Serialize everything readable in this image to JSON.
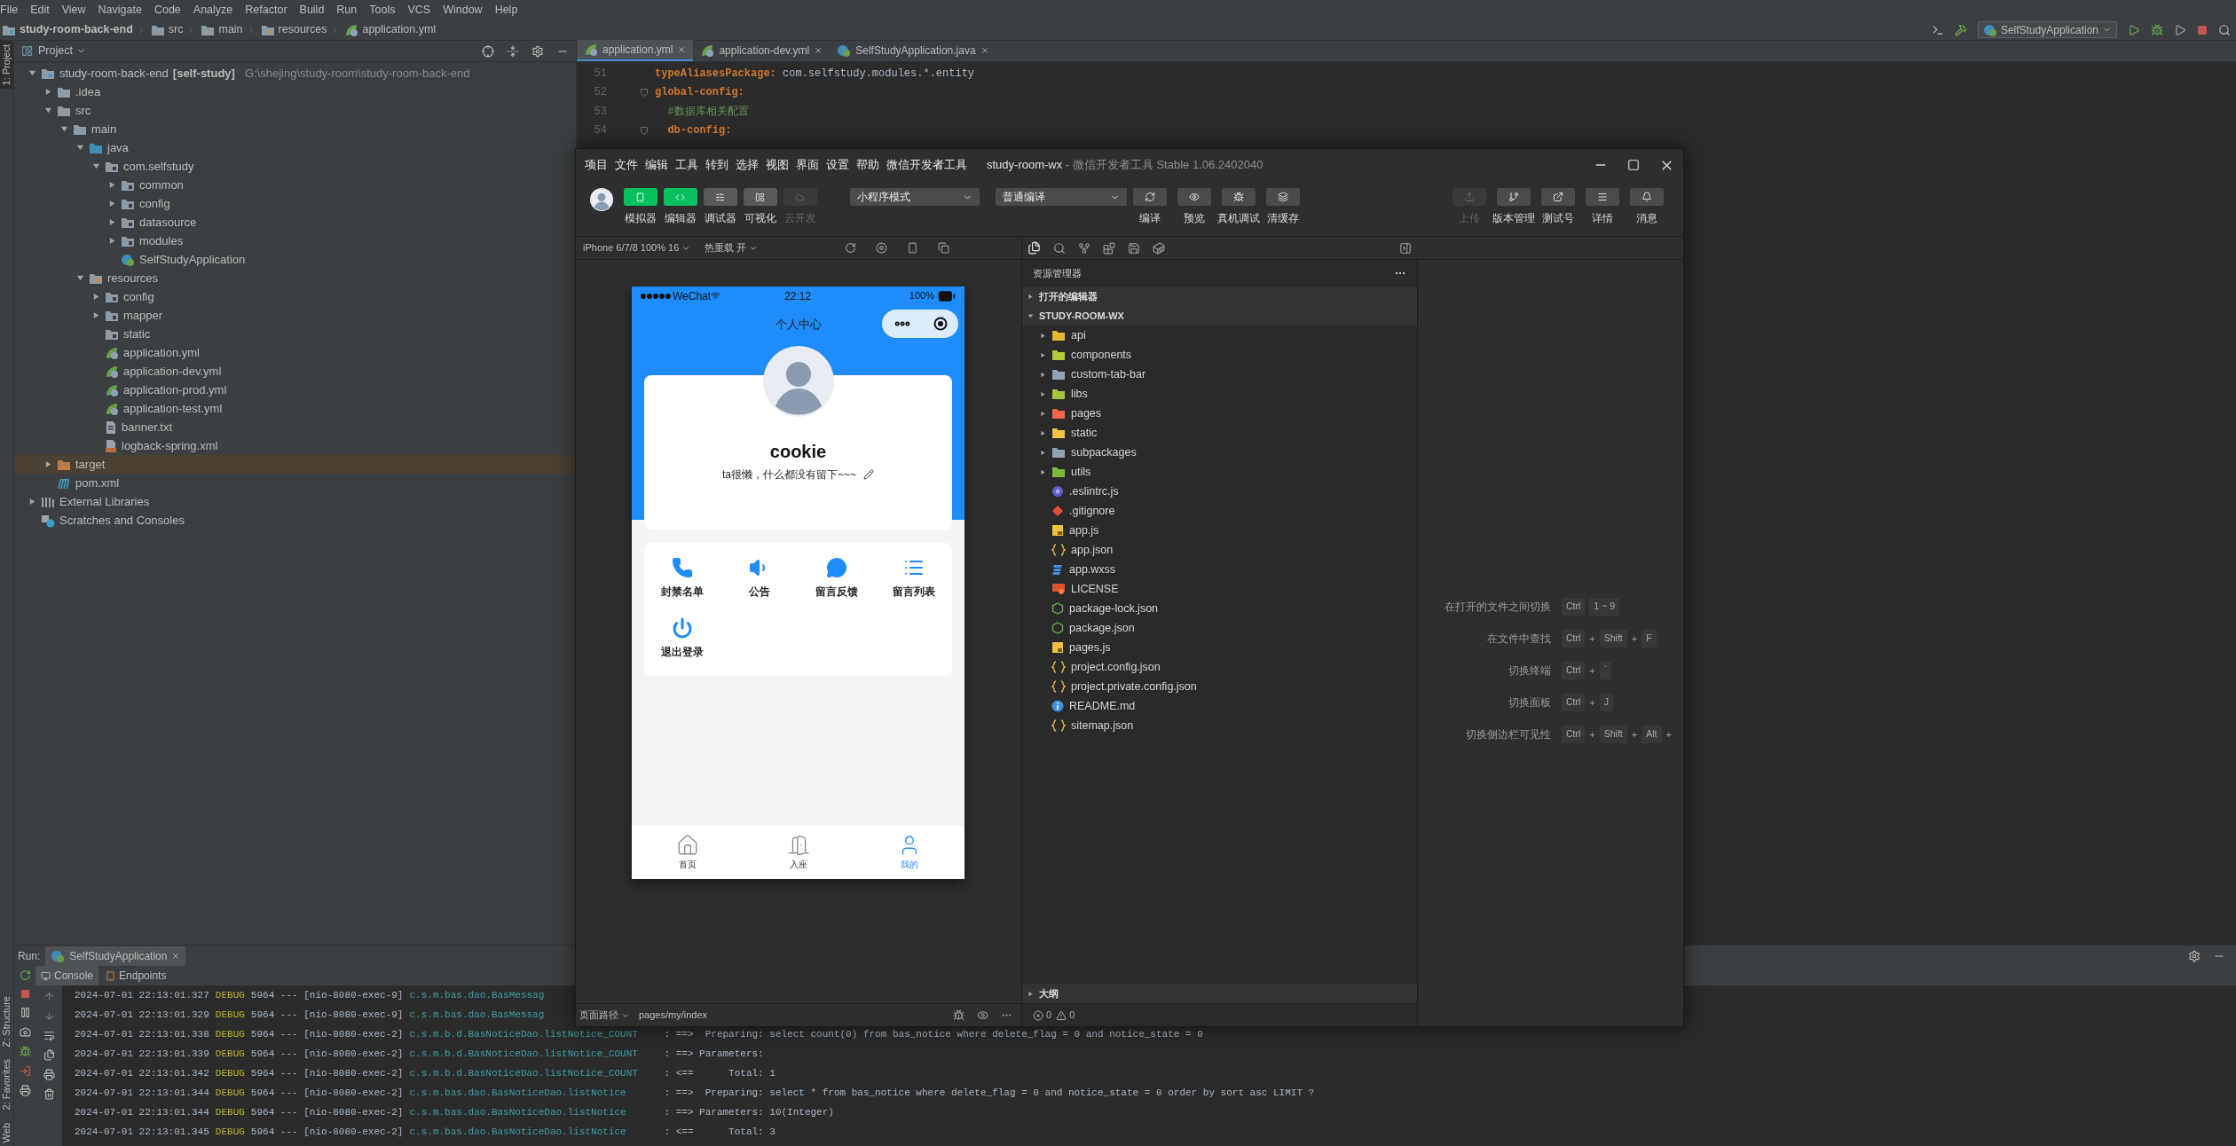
{
  "ide": {
    "menu": [
      "File",
      "Edit",
      "View",
      "Navigate",
      "Code",
      "Analyze",
      "Refactor",
      "Build",
      "Run",
      "Tools",
      "VCS",
      "Window",
      "Help"
    ],
    "breadcrumb": [
      {
        "label": "study-room-back-end",
        "kind": "module"
      },
      {
        "label": "src",
        "kind": "folder"
      },
      {
        "label": "main",
        "kind": "folder"
      },
      {
        "label": "resources",
        "kind": "resources"
      },
      {
        "label": "application.yml",
        "kind": "yml"
      }
    ],
    "run_config": "SelfStudyApplication",
    "side_tabs_top": [
      "1: Project"
    ],
    "side_tabs_bottom": [
      "Z: Structure",
      "2: Favorites",
      "Web"
    ],
    "project_panel": {
      "title": "Project",
      "tree": [
        {
          "label": "study-room-back-end",
          "module": "[self-study]",
          "path": "G:\\shejing\\study-room\\study-room-back-end",
          "kind": "module",
          "expanded": true,
          "children": [
            {
              "label": ".idea",
              "kind": "folder",
              "expanded": false
            },
            {
              "label": "src",
              "kind": "folder",
              "expanded": true,
              "children": [
                {
                  "label": "main",
                  "kind": "folder",
                  "expanded": true,
                  "children": [
                    {
                      "label": "java",
                      "kind": "source-folder",
                      "expanded": true,
                      "children": [
                        {
                          "label": "com.selfstudy",
                          "kind": "package",
                          "expanded": true,
                          "children": [
                            {
                              "label": "common",
                              "kind": "package",
                              "expanded": false
                            },
                            {
                              "label": "config",
                              "kind": "package",
                              "expanded": false
                            },
                            {
                              "label": "datasource",
                              "kind": "package",
                              "expanded": false
                            },
                            {
                              "label": "modules",
                              "kind": "package",
                              "expanded": false
                            },
                            {
                              "label": "SelfStudyApplication",
                              "kind": "spring-class"
                            }
                          ]
                        }
                      ]
                    },
                    {
                      "label": "resources",
                      "kind": "resources",
                      "expanded": true,
                      "children": [
                        {
                          "label": "config",
                          "kind": "package",
                          "expanded": false
                        },
                        {
                          "label": "mapper",
                          "kind": "package",
                          "expanded": false
                        },
                        {
                          "label": "static",
                          "kind": "package"
                        },
                        {
                          "label": "application.yml",
                          "kind": "yml"
                        },
                        {
                          "label": "application-dev.yml",
                          "kind": "yml"
                        },
                        {
                          "label": "application-prod.yml",
                          "kind": "yml"
                        },
                        {
                          "label": "application-test.yml",
                          "kind": "yml"
                        },
                        {
                          "label": "banner.txt",
                          "kind": "text"
                        },
                        {
                          "label": "logback-spring.xml",
                          "kind": "xml"
                        }
                      ]
                    }
                  ]
                }
              ]
            },
            {
              "label": "target",
              "kind": "excluded-folder",
              "expanded": false
            },
            {
              "label": "pom.xml",
              "kind": "maven"
            }
          ]
        },
        {
          "label": "External Libraries",
          "kind": "libraries",
          "expanded": false
        },
        {
          "label": "Scratches and Consoles",
          "kind": "scratches"
        }
      ]
    },
    "editor": {
      "tabs": [
        {
          "label": "application.yml",
          "kind": "yml",
          "selected": true
        },
        {
          "label": "application-dev.yml",
          "kind": "yml",
          "selected": false
        },
        {
          "label": "SelfStudyApplication.java",
          "kind": "spring-class",
          "selected": false
        }
      ],
      "lines": [
        {
          "number": "51",
          "kind": "pair",
          "key": "typeAliasesPackage:",
          "value": " com.selfstudy.modules.*.entity",
          "fold": false
        },
        {
          "number": "52",
          "kind": "key",
          "key": "global-config:",
          "fold": true
        },
        {
          "number": "53",
          "kind": "comment",
          "key": "  #数据库相关配置",
          "fold": false
        },
        {
          "number": "54",
          "kind": "key",
          "key": "  db-config:",
          "fold": true
        }
      ]
    },
    "run_panel": {
      "title": "Run:",
      "tab": "SelfStudyApplication",
      "console_tabs": [
        {
          "label": "Console",
          "selected": true
        },
        {
          "label": "Endpoints",
          "selected": false
        }
      ],
      "log": [
        {
          "time": "2024-07-01 22:13:01.327",
          "level": "DEBUG",
          "meta": "5964 --- [nio-8080-exec-9]",
          "logger": "c.s.m.bas.dao.BasMessag"
        },
        {
          "time": "2024-07-01 22:13:01.329",
          "level": "DEBUG",
          "meta": "5964 --- [nio-8080-exec-9]",
          "logger": "c.s.m.bas.dao.BasMessag"
        },
        {
          "time": "2024-07-01 22:13:01.338",
          "level": "DEBUG",
          "meta": "5964 --- [nio-8080-exec-2]",
          "logger": "c.s.m.b.d.BasNoticeDao.listNotice_COUNT",
          "message": ": ==>  Preparing: select count(0) from bas_notice where delete_flag = 0 and notice_state = 0"
        },
        {
          "time": "2024-07-01 22:13:01.339",
          "level": "DEBUG",
          "meta": "5964 --- [nio-8080-exec-2]",
          "logger": "c.s.m.b.d.BasNoticeDao.listNotice_COUNT",
          "message": ": ==> Parameters: "
        },
        {
          "time": "2024-07-01 22:13:01.342",
          "level": "DEBUG",
          "meta": "5964 --- [nio-8080-exec-2]",
          "logger": "c.s.m.b.d.BasNoticeDao.listNotice_COUNT",
          "message": ": <==      Total: 1"
        },
        {
          "time": "2024-07-01 22:13:01.344",
          "level": "DEBUG",
          "meta": "5964 --- [nio-8080-exec-2]",
          "logger": "c.s.m.bas.dao.BasNoticeDao.listNotice",
          "message": ": ==>  Preparing: select * from bas_notice where delete_flag = 0 and notice_state = 0 order by sort asc LIMIT ?"
        },
        {
          "time": "2024-07-01 22:13:01.344",
          "level": "DEBUG",
          "meta": "5964 --- [nio-8080-exec-2]",
          "logger": "c.s.m.bas.dao.BasNoticeDao.listNotice",
          "message": ": ==> Parameters: 10(Integer)"
        },
        {
          "time": "2024-07-01 22:13:01.345",
          "level": "DEBUG",
          "meta": "5964 --- [nio-8080-exec-2]",
          "logger": "c.s.m.bas.dao.BasNoticeDao.listNotice",
          "message": ": <==      Total: 3"
        }
      ]
    }
  },
  "devtools": {
    "menu": [
      "项目",
      "文件",
      "编辑",
      "工具",
      "转到",
      "选择",
      "视图",
      "界面",
      "设置",
      "帮助",
      "微信开发者工具"
    ],
    "title": "study-room-wx",
    "subtitle": " - 微信开发者工具 Stable 1.06.2402040",
    "view_buttons": [
      {
        "label": "模拟器",
        "on": true,
        "disabled": false
      },
      {
        "label": "编辑器",
        "on": true,
        "disabled": false
      },
      {
        "label": "调试器",
        "on": false,
        "disabled": false
      },
      {
        "label": "可视化",
        "on": false,
        "disabled": false
      },
      {
        "label": "云开发",
        "on": false,
        "disabled": true
      }
    ],
    "mode_select": "小程序模式",
    "compile_select": "普通编译",
    "actions": [
      {
        "label": "编译"
      },
      {
        "label": "预览"
      },
      {
        "label": "真机调试"
      },
      {
        "label": "清缓存"
      }
    ],
    "right_actions": [
      {
        "label": "上传",
        "disabled": true
      },
      {
        "label": "版本管理",
        "disabled": false
      },
      {
        "label": "测试号",
        "disabled": false
      },
      {
        "label": "详情",
        "disabled": false
      },
      {
        "label": "消息",
        "disabled": false
      }
    ],
    "device": "iPhone 6/7/8 100% 16",
    "hot_reload": "热重载 开",
    "phone": {
      "carrier": "WeChat",
      "time": "22:12",
      "battery": "100%",
      "title": "个人中心",
      "name": "cookie",
      "bio": "ta很懒，什么都没有留下~~~",
      "menu": [
        {
          "label": "封禁名单"
        },
        {
          "label": "公告"
        },
        {
          "label": "留言反馈"
        },
        {
          "label": "留言列表"
        },
        {
          "label": "退出登录"
        }
      ],
      "tabs": [
        {
          "label": "首页",
          "selected": false
        },
        {
          "label": "入座",
          "selected": false
        },
        {
          "label": "我的",
          "selected": true
        }
      ]
    },
    "explorer": {
      "title": "资源管理器",
      "sections": [
        {
          "label": "打开的编辑器",
          "expanded": false
        },
        {
          "label": "STUDY-ROOM-WX",
          "expanded": true
        }
      ],
      "files": [
        {
          "label": "api",
          "kind": "folder",
          "color": "#e8b730",
          "expanded": false
        },
        {
          "label": "components",
          "kind": "folder",
          "color": "#b5c93a",
          "expanded": false
        },
        {
          "label": "custom-tab-bar",
          "kind": "folder",
          "color": "#8fa3b8",
          "expanded": false
        },
        {
          "label": "libs",
          "kind": "folder",
          "color": "#a8c63c",
          "expanded": false
        },
        {
          "label": "pages",
          "kind": "folder",
          "color": "#f0644a",
          "expanded": false
        },
        {
          "label": "static",
          "kind": "folder",
          "color": "#f5c342",
          "expanded": false
        },
        {
          "label": "subpackages",
          "kind": "folder",
          "color": "#8fa3b8",
          "expanded": false
        },
        {
          "label": "utils",
          "kind": "folder",
          "color": "#7cba3e",
          "expanded": false
        },
        {
          "label": ".eslintrc.js",
          "kind": "eslint"
        },
        {
          "label": ".gitignore",
          "kind": "git"
        },
        {
          "label": "app.js",
          "kind": "js"
        },
        {
          "label": "app.json",
          "kind": "json"
        },
        {
          "label": "app.wxss",
          "kind": "css"
        },
        {
          "label": "LICENSE",
          "kind": "license"
        },
        {
          "label": "package-lock.json",
          "kind": "npm"
        },
        {
          "label": "package.json",
          "kind": "npm"
        },
        {
          "label": "pages.js",
          "kind": "js"
        },
        {
          "label": "project.config.json",
          "kind": "json"
        },
        {
          "label": "project.private.config.json",
          "kind": "json"
        },
        {
          "label": "README.md",
          "kind": "info"
        },
        {
          "label": "sitemap.json",
          "kind": "json"
        }
      ],
      "outline": {
        "label": "大纲",
        "expanded": false
      }
    },
    "shortcuts": [
      {
        "label": "在打开的文件之间切换",
        "keys": [
          {
            "text": "Ctrl",
            "kind": "key"
          },
          {
            "text": "1 ~ 9",
            "kind": "key"
          }
        ]
      },
      {
        "label": "在文件中查找",
        "keys": [
          {
            "text": "Ctrl",
            "kind": "key"
          },
          {
            "text": "+",
            "kind": "plus"
          },
          {
            "text": "Shift",
            "kind": "key"
          },
          {
            "text": "+",
            "kind": "plus"
          },
          {
            "text": "F",
            "kind": "key"
          }
        ]
      },
      {
        "label": "切换终端",
        "keys": [
          {
            "text": "Ctrl",
            "kind": "key"
          },
          {
            "text": "+",
            "kind": "plus"
          },
          {
            "text": "`",
            "kind": "key"
          }
        ]
      },
      {
        "label": "切换面板",
        "keys": [
          {
            "text": "Ctrl",
            "kind": "key"
          },
          {
            "text": "+",
            "kind": "plus"
          },
          {
            "text": "J",
            "kind": "key"
          }
        ]
      },
      {
        "label": "切换侧边栏可见性",
        "keys": [
          {
            "text": "Ctrl",
            "kind": "key"
          },
          {
            "text": "+",
            "kind": "plus"
          },
          {
            "text": "Shift",
            "kind": "key"
          },
          {
            "text": "+",
            "kind": "plus"
          },
          {
            "text": "Alt",
            "kind": "key"
          },
          {
            "text": "+",
            "kind": "plus"
          }
        ]
      }
    ],
    "page_path_label": "页面路径",
    "page_path": "pages/my/index",
    "errors": "0",
    "warnings": "0"
  }
}
